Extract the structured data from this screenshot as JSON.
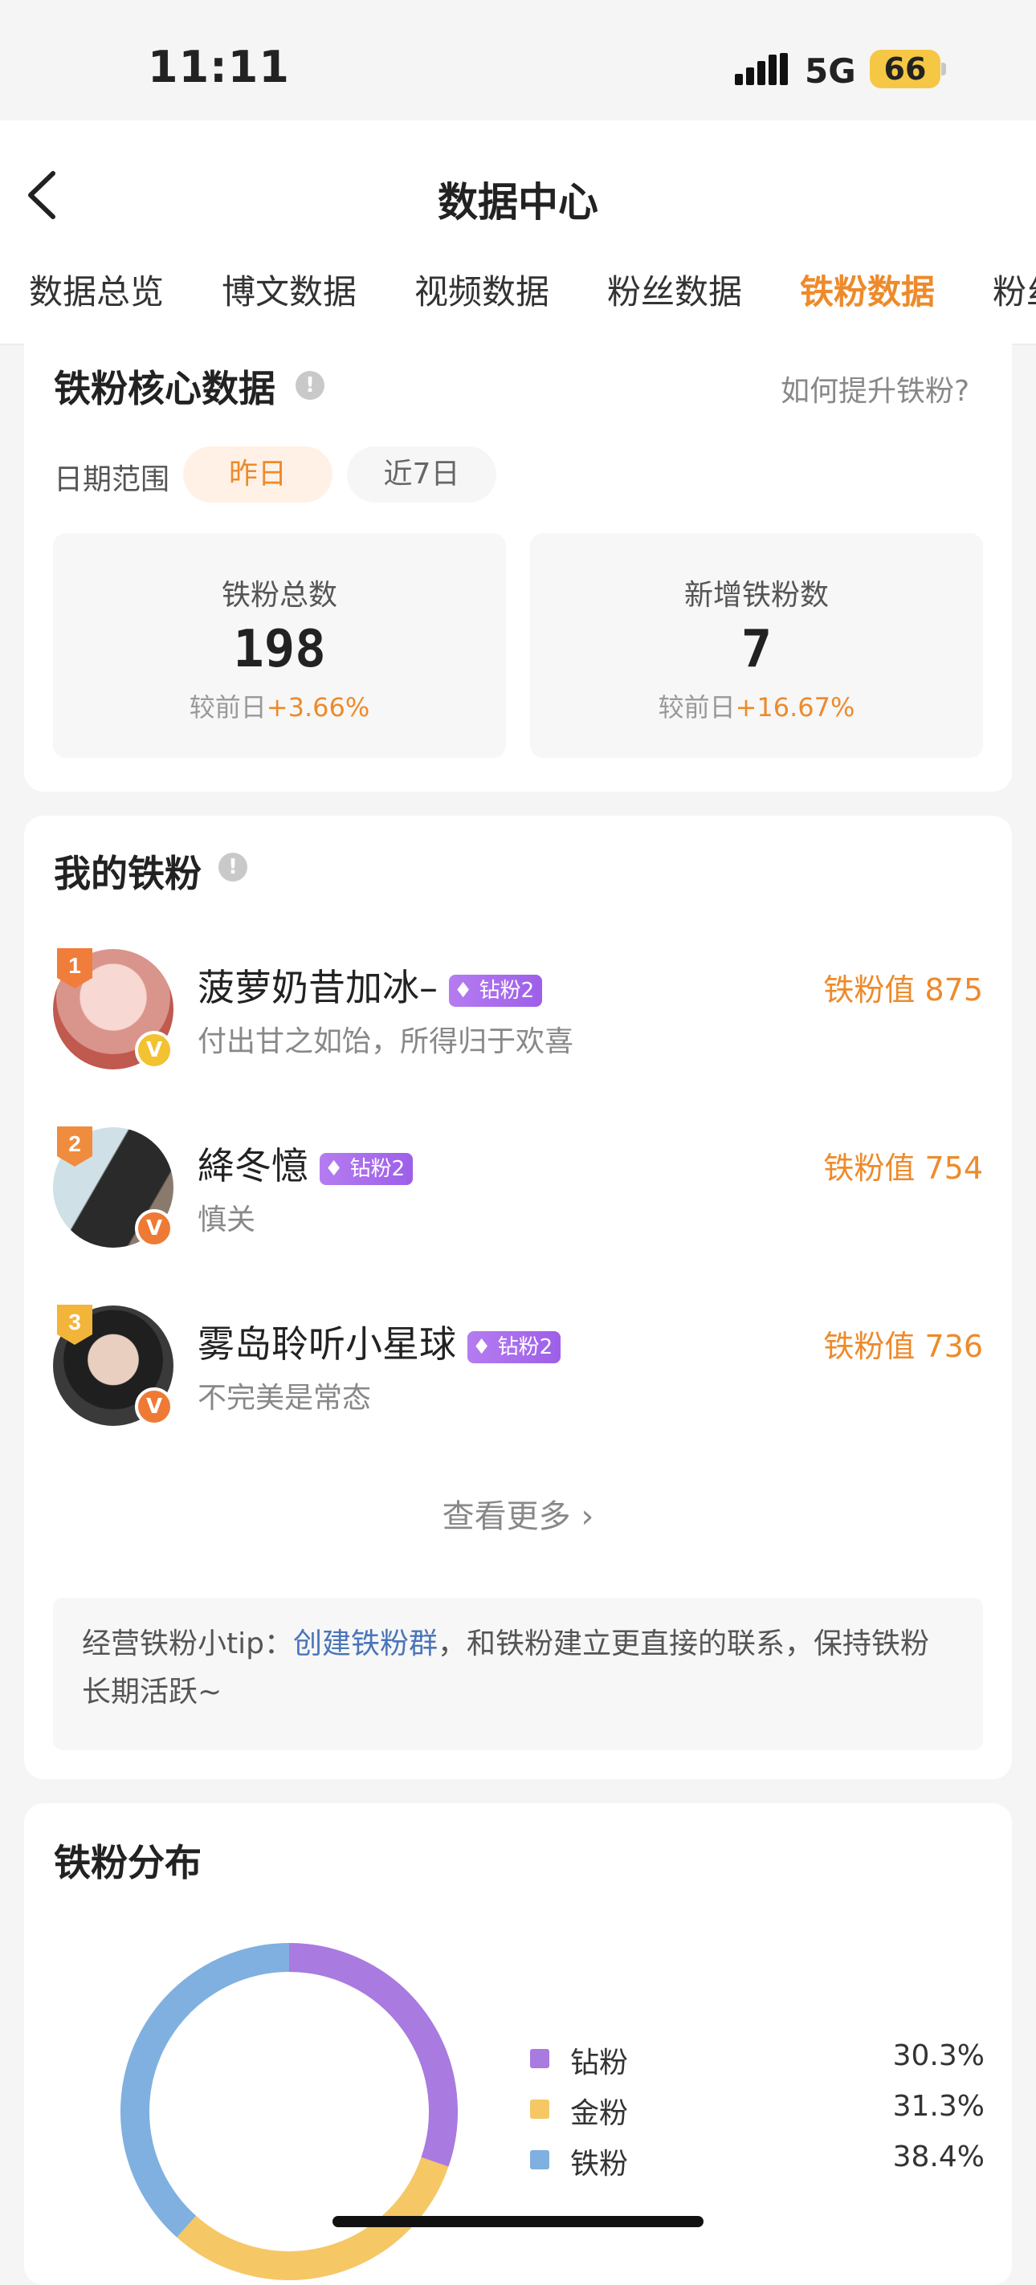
{
  "status_bar": {
    "time": "11:11",
    "network": "5G",
    "battery": "66"
  },
  "header": {
    "title": "数据中心"
  },
  "tabs": [
    {
      "label": "数据总览",
      "active": false
    },
    {
      "label": "博文数据",
      "active": false
    },
    {
      "label": "视频数据",
      "active": false
    },
    {
      "label": "粉丝数据",
      "active": false
    },
    {
      "label": "铁粉数据",
      "active": true
    },
    {
      "label": "粉丝",
      "active": false
    }
  ],
  "core": {
    "title": "铁粉核心数据",
    "help_link": "如何提升铁粉?",
    "date_range_label": "日期范围",
    "date_options": [
      "昨日",
      "近7日"
    ],
    "selected_date": "昨日",
    "stats": [
      {
        "label": "铁粉总数",
        "value": "198",
        "compare_prefix": "较前日",
        "change": "+3.66%"
      },
      {
        "label": "新增铁粉数",
        "value": "7",
        "compare_prefix": "较前日",
        "change": "+16.67%"
      }
    ]
  },
  "my_fans": {
    "title": "我的铁粉",
    "items": [
      {
        "rank": "1",
        "name": "菠萝奶昔加冰–",
        "level": "钻粉2",
        "signature": "付出甘之如饴，所得归于欢喜",
        "value_label": "铁粉值",
        "value": "875",
        "rank_color": "#f07d3a",
        "v_color": "#f2c230"
      },
      {
        "rank": "2",
        "name": "絳冬憶",
        "level": "钻粉2",
        "signature": "慎关",
        "value_label": "铁粉值",
        "value": "754",
        "rank_color": "#f08c3e",
        "v_color": "#ef7a35"
      },
      {
        "rank": "3",
        "name": "雾岛聆听小星球",
        "level": "钻粉2",
        "signature": "不完美是常态",
        "value_label": "铁粉值",
        "value": "736",
        "rank_color": "#f3b43a",
        "v_color": "#ef7a35"
      }
    ],
    "more_label": "查看更多",
    "tip_prefix": "经营铁粉小tip：",
    "tip_link": "创建铁粉群",
    "tip_suffix": "，和铁粉建立更直接的联系，保持铁粉长期活跃~"
  },
  "distribution": {
    "title": "铁粉分布",
    "chart_data": {
      "type": "pie",
      "categories": [
        "钻粉",
        "金粉",
        "铁粉"
      ],
      "values": [
        30.3,
        31.3,
        38.4
      ],
      "labels": [
        "30.3%",
        "31.3%",
        "38.4%"
      ],
      "colors": [
        "#a97ae0",
        "#f5c765",
        "#7fb0e0"
      ],
      "donut": true,
      "legend": "right"
    }
  }
}
